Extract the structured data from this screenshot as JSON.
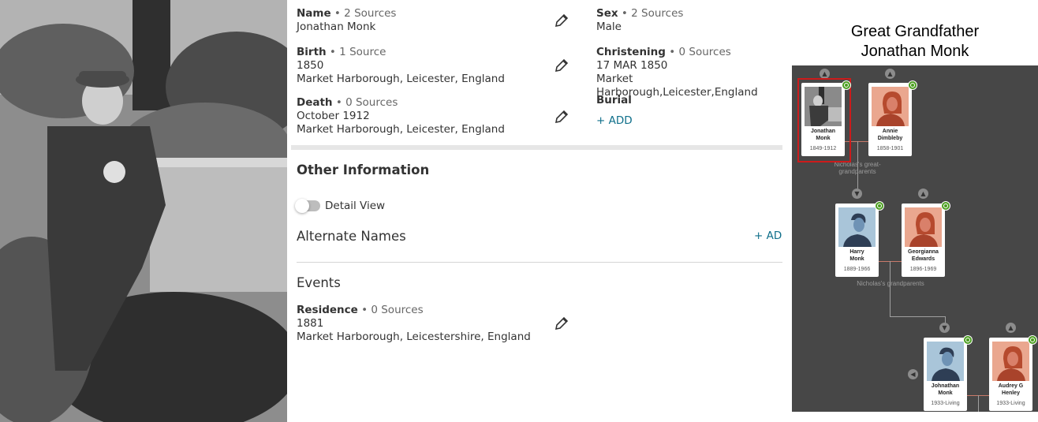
{
  "facts": {
    "name": {
      "label": "Name",
      "sources": " • 2 Sources",
      "value": "Jonathan Monk"
    },
    "sex": {
      "label": "Sex",
      "sources": " • 2 Sources",
      "value": "Male"
    },
    "birth": {
      "label": "Birth",
      "sources": " • 1 Source",
      "date": "1850",
      "place": "Market Harborough, Leicester, England"
    },
    "christening": {
      "label": "Christening",
      "sources": " • 0 Sources",
      "date": "17 MAR 1850",
      "place": "Market Harborough,Leicester,England"
    },
    "death": {
      "label": "Death",
      "sources": " • 0 Sources",
      "date": "October 1912",
      "place": "Market Harborough, Leicester, England"
    },
    "burial": {
      "label": "Burial",
      "add": "+  ADD"
    }
  },
  "other_info": {
    "heading": "Other Information",
    "detail_view": "Detail View",
    "alternate_names": "Alternate Names",
    "alt_add": "+  ADD",
    "events_heading": "Events",
    "residence": {
      "label": "Residence",
      "sources": " • 0 Sources",
      "date": "1881",
      "place": "Market Harborough, Leicestershire, England"
    }
  },
  "caption": {
    "line1": "Great Grandfather",
    "line2": "Jonathan Monk"
  },
  "tree": {
    "great_grandparents_label": "Nicholas's great-grandparents",
    "grandparents_label": "Nicholas's grandparents",
    "people": [
      {
        "first": "Jonathan",
        "last": "Monk",
        "dates": "1849-1912"
      },
      {
        "first": "Annie",
        "last": "Dimbleby",
        "dates": "1858-1901"
      },
      {
        "first": "Harry",
        "last": "Monk",
        "dates": "1889-1966"
      },
      {
        "first": "Georgianna",
        "last": "Edwards",
        "dates": "1896-1969"
      },
      {
        "first": "Johnathan",
        "last": "Monk",
        "dates": "1933-Living"
      },
      {
        "first": "Audrey G",
        "last": "Henley",
        "dates": "1933-Living"
      }
    ]
  },
  "icons": {
    "edit": "pencil-icon",
    "expand": "chevron-up-icon",
    "collapse": "chevron-down-icon",
    "hint": "leaf-hint-icon"
  },
  "colors": {
    "link": "#0f6f8a",
    "tree_bg": "#474747",
    "hint_badge": "#4b9e20",
    "selected_border": "#cc1b1b",
    "female_bg": "#eaa78f",
    "male_bg": "#a9c5d9"
  }
}
